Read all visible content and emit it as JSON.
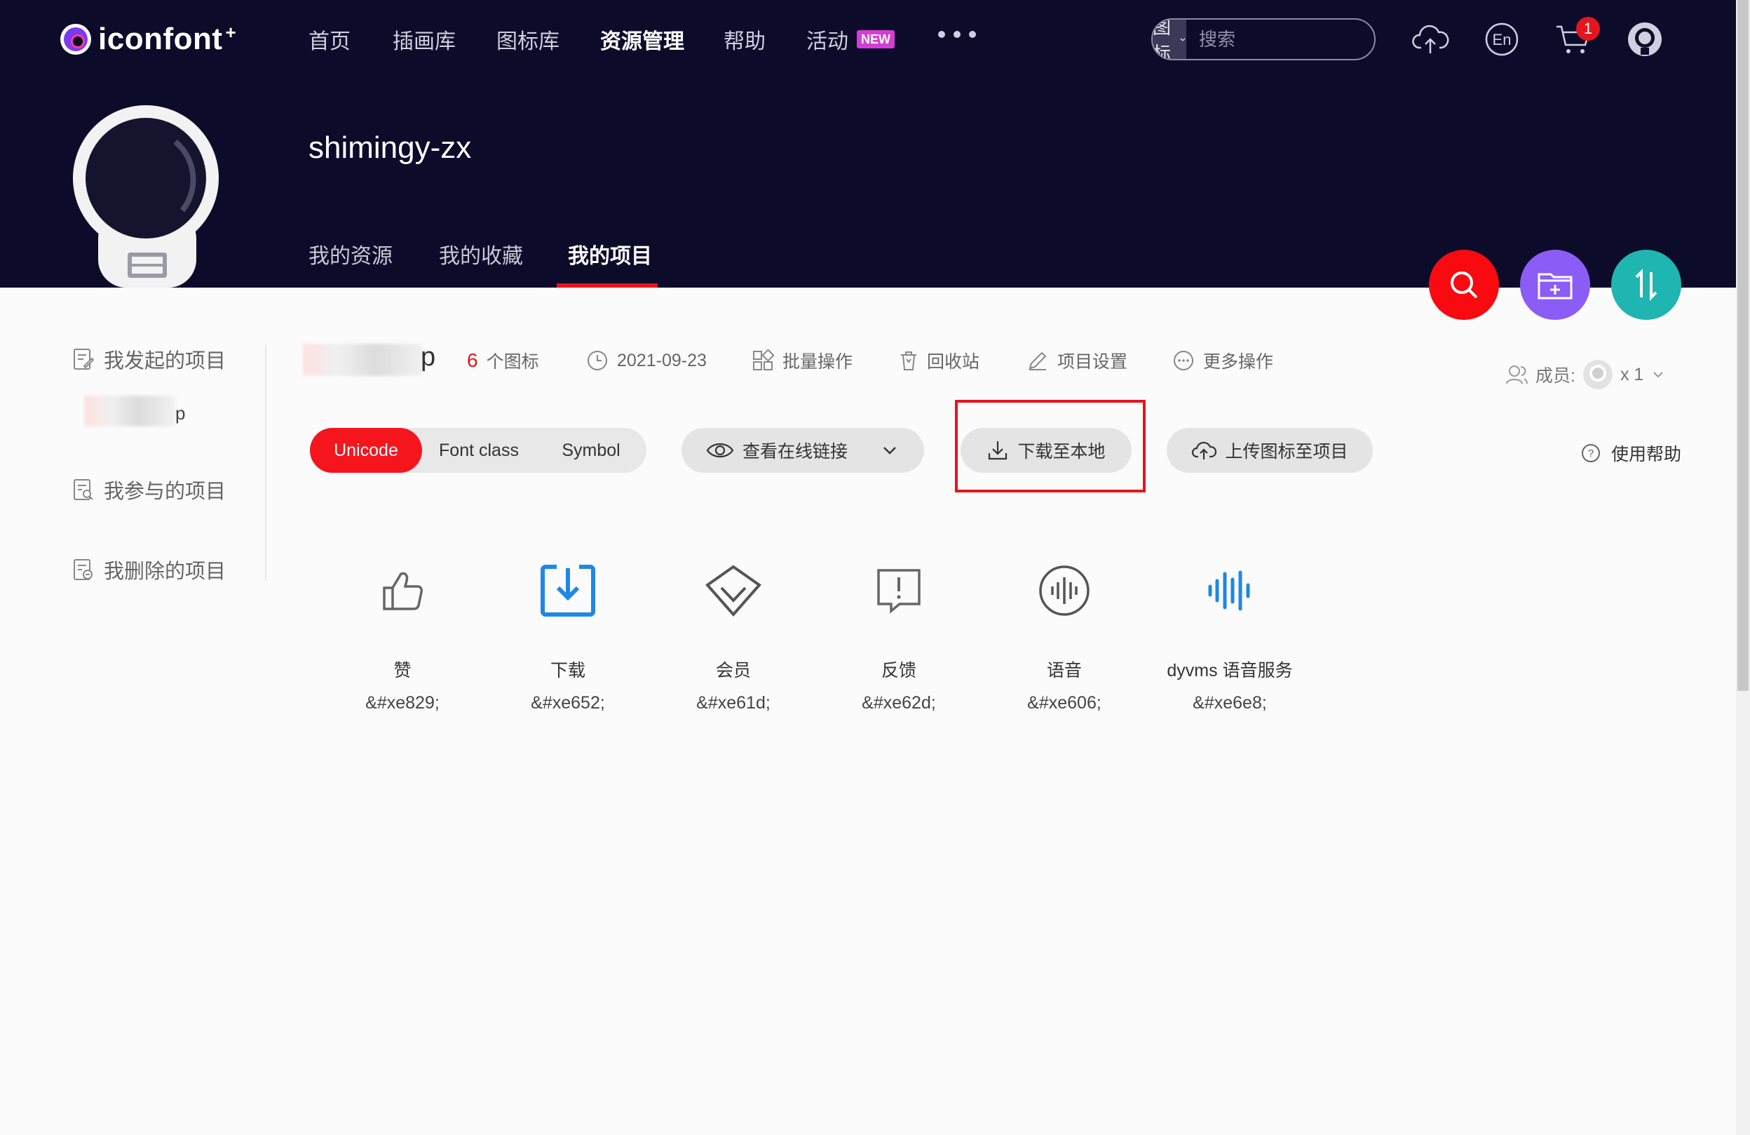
{
  "app": {
    "brand": "iconfont",
    "brand_plus": "+"
  },
  "topnav": {
    "items": [
      "首页",
      "插画库",
      "图标库",
      "资源管理",
      "帮助",
      "活动"
    ],
    "new_badge": "NEW"
  },
  "search": {
    "type_label": "图标",
    "placeholder": "搜索"
  },
  "cart_count": "1",
  "user": {
    "name": "shimingy-zx"
  },
  "subtabs": [
    "我的资源",
    "我的收藏",
    "我的项目"
  ],
  "project_nav": {
    "initiated": "我发起的项目",
    "project_item_tail": "p",
    "participated": "我参与的项目",
    "deleted": "我删除的项目"
  },
  "project": {
    "name_tail": "p",
    "icon_count": "6",
    "icon_count_unit": "个图标",
    "date": "2021-09-23",
    "batch": "批量操作",
    "recycle": "回收站",
    "settings": "项目设置",
    "more": "更多操作",
    "members_label": "成员:",
    "members_count": "x 1"
  },
  "controls": {
    "seg": [
      "Unicode",
      "Font class",
      "Symbol"
    ],
    "online_link": "查看在线链接",
    "download_local": "下载至本地",
    "upload": "上传图标至项目",
    "help": "使用帮助"
  },
  "icons": [
    {
      "name": "赞",
      "code": "&#xe829;",
      "icon": "thumbs-up-icon"
    },
    {
      "name": "下载",
      "code": "&#xe652;",
      "icon": "download-icon"
    },
    {
      "name": "会员",
      "code": "&#xe61d;",
      "icon": "member-diamond-icon"
    },
    {
      "name": "反馈",
      "code": "&#xe62d;",
      "icon": "feedback-icon"
    },
    {
      "name": "语音",
      "code": "&#xe606;",
      "icon": "voice-icon"
    },
    {
      "name": "dyvms 语音服务",
      "code": "&#xe6e8;",
      "icon": "voice-service-icon"
    }
  ],
  "colors": {
    "header_bg": "#0d0b2a",
    "accent_red": "#e4151d",
    "fab_purple": "#8b5cf6",
    "fab_teal": "#1fb5b0",
    "icon_blue": "#1e88e5",
    "badge_magenta": "#d63cd6"
  }
}
